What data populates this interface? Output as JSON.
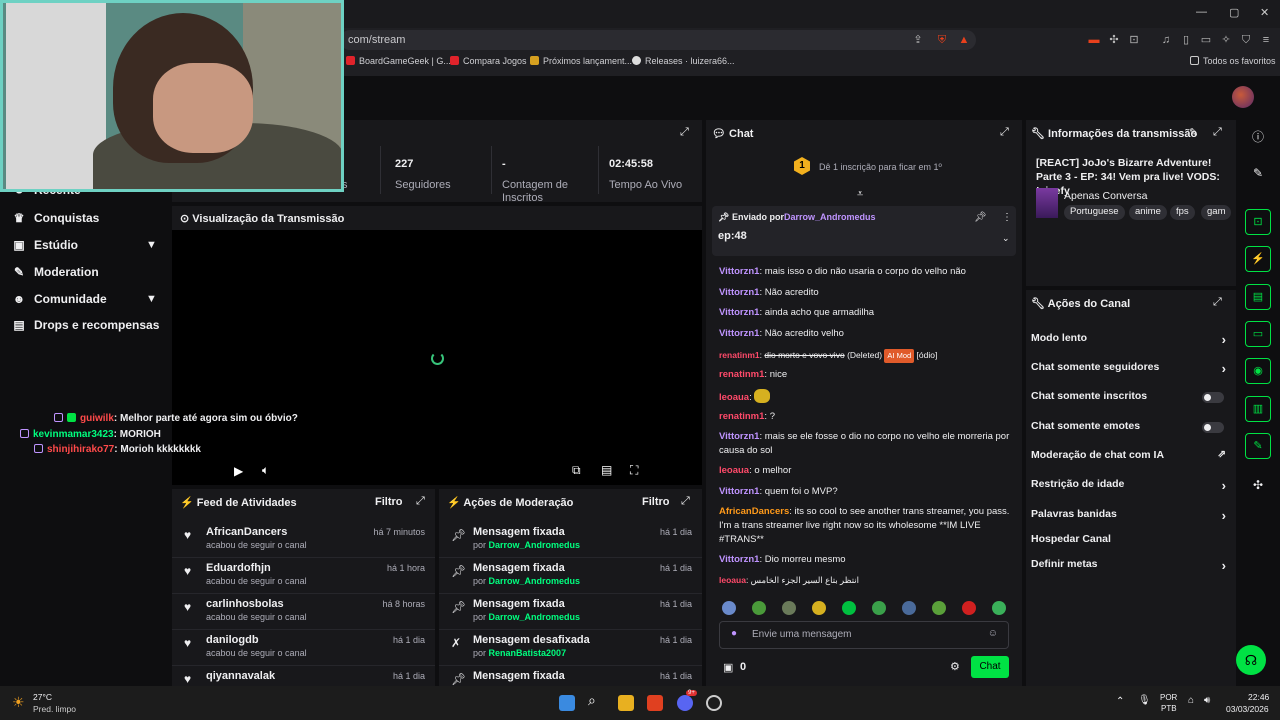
{
  "browser": {
    "url": "com/stream",
    "bookmarks": [
      "BoardGameGeek | G...",
      "Compara Jogos",
      "Próximos lançament...",
      "Releases · luizera66..."
    ],
    "favorites": "Todos os favoritos"
  },
  "sidebar": {
    "items": [
      {
        "label": "Recente",
        "icon": "history-icon"
      },
      {
        "label": "Conquistas",
        "icon": "trophy-icon"
      },
      {
        "label": "Estúdio",
        "icon": "video-icon"
      },
      {
        "label": "Moderation",
        "icon": "wrench-icon"
      },
      {
        "label": "Comunidade",
        "icon": "people-icon"
      },
      {
        "label": "Drops e recompensas",
        "icon": "gift-icon"
      }
    ]
  },
  "stats": {
    "items": [
      {
        "value": "",
        "label": "s"
      },
      {
        "value": "227",
        "label": "Seguidores"
      },
      {
        "value": "-",
        "label": "Contagem de Inscritos"
      },
      {
        "value": "02:45:58",
        "label": "Tempo Ao Vivo"
      }
    ]
  },
  "preview": {
    "title": "Visualização da Transmissão"
  },
  "overlay_chat": [
    {
      "user": "guiwilk",
      "msg": "Melhor parte até agora sim ou óbvio?",
      "color": "#ff4a4a"
    },
    {
      "user": "kevinmamar3423",
      "msg": "MORIOH",
      "color": "#00ff7f"
    },
    {
      "user": "shinjihirako77",
      "msg": "Morioh kkkkkkkk",
      "color": "#ff4a4a"
    }
  ],
  "activity": {
    "title": "Feed de Atividades",
    "filter": "Filtro",
    "items": [
      {
        "name": "AfricanDancers",
        "sub": "acabou de seguir o canal",
        "time": "há 7 minutos"
      },
      {
        "name": "Eduardofhjn",
        "sub": "acabou de seguir o canal",
        "time": "há 1 hora"
      },
      {
        "name": "carlinhosbolas",
        "sub": "acabou de seguir o canal",
        "time": "há 8 horas"
      },
      {
        "name": "danilogdb",
        "sub": "acabou de seguir o canal",
        "time": "há 1 dia"
      },
      {
        "name": "qiyannavalak",
        "sub": "",
        "time": "há 1 dia"
      }
    ]
  },
  "moderation": {
    "title": "Ações de Moderação",
    "filter": "Filtro",
    "items": [
      {
        "name": "Mensagem fixada",
        "by": "por",
        "user": "Darrow_Andromedus",
        "time": "há 1 dia"
      },
      {
        "name": "Mensagem fixada",
        "by": "por",
        "user": "Darrow_Andromedus",
        "time": "há 1 dia"
      },
      {
        "name": "Mensagem fixada",
        "by": "por",
        "user": "Darrow_Andromedus",
        "time": "há 1 dia"
      },
      {
        "name": "Mensagem desafixada",
        "by": "por",
        "user": "RenanBatista2007",
        "time": "há 1 dia"
      },
      {
        "name": "Mensagem fixada",
        "by": "",
        "user": "",
        "time": "há 1 dia"
      }
    ]
  },
  "chat": {
    "title": "Chat",
    "sub_goal": "Dê 1 inscrição para ficar em 1º",
    "sub_rank": "1",
    "pinned_by": "Enviado por",
    "pinned_user": "Darrow_Andromedus",
    "pinned_msg": "ep:48",
    "messages": [
      {
        "user": "Vittorzn1",
        "text": "mais isso o dio não usaria o corpo do velho não",
        "color": "#bf94ff"
      },
      {
        "user": "Vittorzn1",
        "text": "Não acredito",
        "color": "#bf94ff"
      },
      {
        "user": "Vittorzn1",
        "text": "ainda acho que armadilha",
        "color": "#bf94ff"
      },
      {
        "user": "Vittorzn1",
        "text": "Não acredito velho",
        "color": "#bf94ff"
      },
      {
        "user": "renatinm1",
        "text": "dio morto e vovo vivo",
        "color": "#ff4a6a",
        "deleted": "(Deleted)",
        "tag": "AI Mod",
        "tag2": "[ódio]"
      },
      {
        "user": "renatinm1",
        "text": "nice",
        "color": "#ff4a6a"
      },
      {
        "user": "leoaua",
        "text": "",
        "color": "#ff4a6a"
      },
      {
        "user": "renatinm1",
        "text": "?",
        "color": "#ff4a6a"
      },
      {
        "user": "Vittorzn1",
        "text": "mais se ele fosse o dio no corpo no velho ele morreria por causa do sol",
        "color": "#bf94ff"
      },
      {
        "user": "leoaua",
        "text": "o melhor",
        "color": "#ff4a6a"
      },
      {
        "user": "Vittorzn1",
        "text": "quem foi o MVP?",
        "color": "#bf94ff"
      },
      {
        "user": "AfricanDancers",
        "text": "its so cool to see another trans streamer, you pass. I'm a trans streamer live right now so its wholesome **IM LIVE #TRANS**",
        "color": "#ff9a1a"
      },
      {
        "user": "Vittorzn1",
        "text": "Dio morreu mesmo",
        "color": "#bf94ff"
      },
      {
        "user": "leoaua",
        "text": "انتظر بتاع السير الجزء الخامس",
        "color": "#ff4a6a"
      }
    ],
    "input_placeholder": "Envie uma mensagem",
    "points": "0",
    "send_label": "Chat"
  },
  "info": {
    "title": "Informações da transmissão",
    "stream_title": "[REACT] JoJo's Bizarre Adventure! Parte 3 - EP: 34! Vem pra live! VODS: !cinefy",
    "category": "Apenas Conversa",
    "tags": [
      "Portuguese",
      "anime",
      "fps",
      "gam"
    ]
  },
  "channel_actions": {
    "title": "Ações do Canal",
    "items": [
      {
        "label": "Modo lento",
        "kind": "chevron"
      },
      {
        "label": "Chat somente seguidores",
        "kind": "chevron"
      },
      {
        "label": "Chat somente inscritos",
        "kind": "toggle"
      },
      {
        "label": "Chat somente emotes",
        "kind": "toggle"
      },
      {
        "label": "Moderação de chat com IA",
        "kind": "external"
      },
      {
        "label": "Restrição de idade",
        "kind": "chevron"
      },
      {
        "label": "Palavras banidas",
        "kind": "chevron"
      },
      {
        "label": "Hospedar Canal",
        "kind": "none"
      },
      {
        "label": "Definir metas",
        "kind": "chevron"
      }
    ]
  },
  "taskbar": {
    "weather_temp": "27°C",
    "weather_desc": "Pred. limpo",
    "lang": "POR",
    "layout": "PTB",
    "time": "22:46",
    "date": "03/03/2026",
    "discord_badge": "9+"
  },
  "colors": {
    "accent": "#00e244",
    "brand_purple": "#bf94ff",
    "panel": "#18181b"
  }
}
